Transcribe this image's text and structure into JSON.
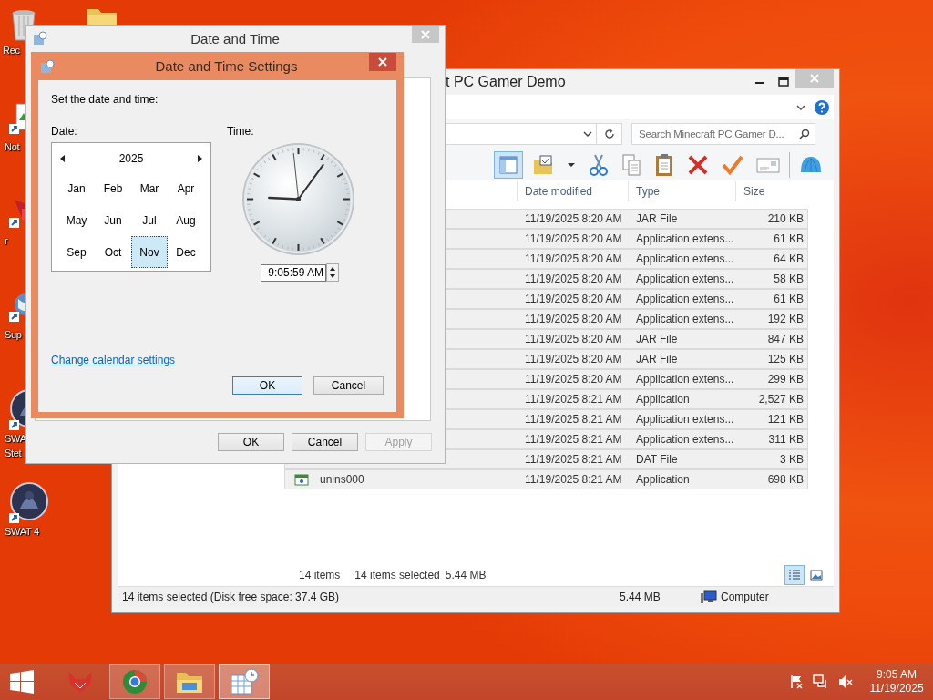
{
  "desktop": {
    "icons": [
      {
        "kind": "recycle",
        "label_lines": [
          "Rec"
        ]
      },
      {
        "kind": "folder"
      },
      {
        "kind": "notepad",
        "label_lines": [
          "Not"
        ]
      },
      {
        "kind": "red",
        "label_lines": [
          "r"
        ]
      },
      {
        "kind": "globe",
        "label_lines": [
          "Sup"
        ]
      },
      {
        "kind": "game",
        "label_lines": [
          "SWA",
          "Stet"
        ]
      },
      {
        "kind": "game",
        "label_lines": [
          "SWAT 4"
        ]
      }
    ]
  },
  "explorer": {
    "title": "t PC Gamer Demo",
    "search_placeholder": "Search Minecraft PC Gamer D...",
    "toolbar": [
      {
        "kind": "layout",
        "selected": true
      },
      {
        "kind": "folder",
        "selected": false
      },
      {
        "kind": "caret",
        "selected": false
      },
      {
        "kind": "cut",
        "selected": false
      },
      {
        "kind": "copy",
        "selected": false
      },
      {
        "kind": "paste",
        "selected": false
      },
      {
        "kind": "delete",
        "selected": false
      },
      {
        "kind": "check",
        "selected": false
      },
      {
        "kind": "card",
        "selected": false
      },
      {
        "kind": "shell",
        "selected": false
      }
    ],
    "columns": [
      "Date modified",
      "Type",
      "Size"
    ],
    "rows": [
      {
        "date": "11/19/2025 8:20 AM",
        "type": "JAR File",
        "size": "210 KB",
        "selected": true
      },
      {
        "date": "11/19/2025 8:20 AM",
        "type": "Application extens...",
        "size": "61 KB",
        "selected": true
      },
      {
        "date": "11/19/2025 8:20 AM",
        "type": "Application extens...",
        "size": "64 KB",
        "selected": true
      },
      {
        "date": "11/19/2025 8:20 AM",
        "type": "Application extens...",
        "size": "58 KB",
        "selected": true
      },
      {
        "date": "11/19/2025 8:20 AM",
        "type": "Application extens...",
        "size": "61 KB",
        "selected": true
      },
      {
        "date": "11/19/2025 8:20 AM",
        "type": "Application extens...",
        "size": "192 KB",
        "selected": true
      },
      {
        "date": "11/19/2025 8:20 AM",
        "type": "JAR File",
        "size": "847 KB",
        "selected": true
      },
      {
        "date": "11/19/2025 8:20 AM",
        "type": "JAR File",
        "size": "125 KB",
        "selected": true
      },
      {
        "date": "11/19/2025 8:20 AM",
        "type": "Application extens...",
        "size": "299 KB",
        "selected": true
      },
      {
        "date": "11/19/2025 8:21 AM",
        "type": "Application",
        "size": "2,527 KB",
        "selected": true
      },
      {
        "date": "11/19/2025 8:21 AM",
        "type": "Application extens...",
        "size": "121 KB",
        "selected": true
      },
      {
        "date": "11/19/2025 8:21 AM",
        "type": "Application extens...",
        "size": "311 KB",
        "selected": true
      },
      {
        "date": "11/19/2025 8:21 AM",
        "type": "DAT File",
        "size": "3 KB",
        "selected": true
      },
      {
        "name": "unins000",
        "date": "11/19/2025 8:21 AM",
        "type": "Application",
        "size": "698 KB",
        "selected": true
      }
    ],
    "item_count": "14 items",
    "selected_count": "14 items selected",
    "selected_size": "5.44 MB",
    "view_buttons": [
      {
        "kind": "details",
        "selected": true
      },
      {
        "kind": "thumbnails",
        "selected": false
      }
    ],
    "status_bar": {
      "text": "14 items selected (Disk free space: 37.4 GB)",
      "size": "5.44 MB",
      "location": "Computer"
    }
  },
  "date_time_dialog": {
    "title": "Date and Time",
    "buttons": [
      {
        "label": "OK",
        "disabled": false
      },
      {
        "label": "Cancel",
        "disabled": false
      },
      {
        "label": "Apply",
        "disabled": true
      }
    ]
  },
  "settings_dialog": {
    "title": "Date and Time Settings",
    "prompt": "Set the date and time:",
    "date_label": "Date:",
    "time_label": "Time:",
    "year": "2025",
    "months": [
      {
        "label": "Jan",
        "selected": false
      },
      {
        "label": "Feb",
        "selected": false
      },
      {
        "label": "Mar",
        "selected": false
      },
      {
        "label": "Apr",
        "selected": false
      },
      {
        "label": "May",
        "selected": false
      },
      {
        "label": "Jun",
        "selected": false
      },
      {
        "label": "Jul",
        "selected": false
      },
      {
        "label": "Aug",
        "selected": false
      },
      {
        "label": "Sep",
        "selected": false
      },
      {
        "label": "Oct",
        "selected": false
      },
      {
        "label": "Nov",
        "selected": true
      },
      {
        "label": "Dec",
        "selected": false
      }
    ],
    "time_value": "9:05:59 AM",
    "link": "Change calendar settings",
    "buttons": [
      {
        "label": "OK",
        "default": true
      },
      {
        "label": "Cancel",
        "default": false
      }
    ]
  },
  "taskbar": {
    "apps": [
      {
        "kind": "fox",
        "running": false,
        "selected": false
      },
      {
        "kind": "browser",
        "running": true,
        "selected": false
      },
      {
        "kind": "folder",
        "running": true,
        "selected": false
      },
      {
        "kind": "calendar",
        "running": true,
        "selected": true
      }
    ],
    "time": "9:05 AM",
    "date": "11/19/2025"
  }
}
